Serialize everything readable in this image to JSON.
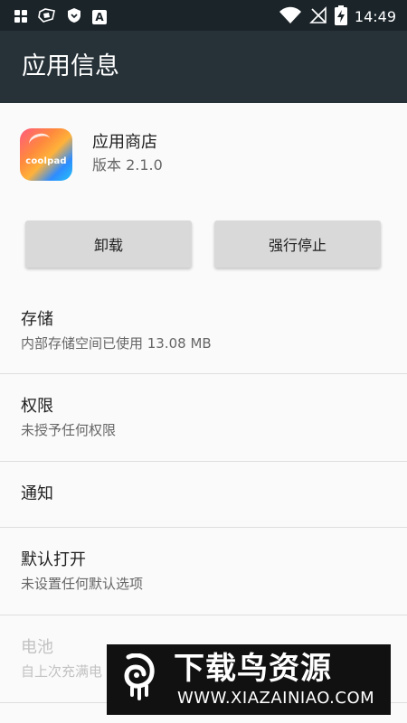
{
  "status_bar": {
    "time": "14:49",
    "app_icon_letter": "A",
    "icons": [
      "gallery-icon",
      "game-icon",
      "shield-icon",
      "a-app-icon",
      "wifi-icon",
      "no-signal-icon",
      "battery-charging-icon"
    ]
  },
  "app_bar": {
    "title": "应用信息"
  },
  "app": {
    "name": "应用商店",
    "version": "版本 2.1.0",
    "icon_text": "coolpad"
  },
  "buttons": {
    "uninstall": "卸载",
    "force_stop": "强行停止"
  },
  "sections": [
    {
      "title": "存储",
      "subtitle": "内部存储空间已使用 13.08 MB",
      "enabled": true
    },
    {
      "title": "权限",
      "subtitle": "未授予任何权限",
      "enabled": true
    },
    {
      "title": "通知",
      "subtitle": "",
      "enabled": true
    },
    {
      "title": "默认打开",
      "subtitle": "未设置任何默认选项",
      "enabled": true
    },
    {
      "title": "电池",
      "subtitle": "自上次充满电",
      "enabled": false
    }
  ],
  "watermark": {
    "title": "下载鸟资源",
    "url": "WWW.XIAZAINIAO.COM"
  },
  "colors": {
    "app_bar": "#263238",
    "status_bar": "#1b2429",
    "button": "#d9d9d9"
  }
}
